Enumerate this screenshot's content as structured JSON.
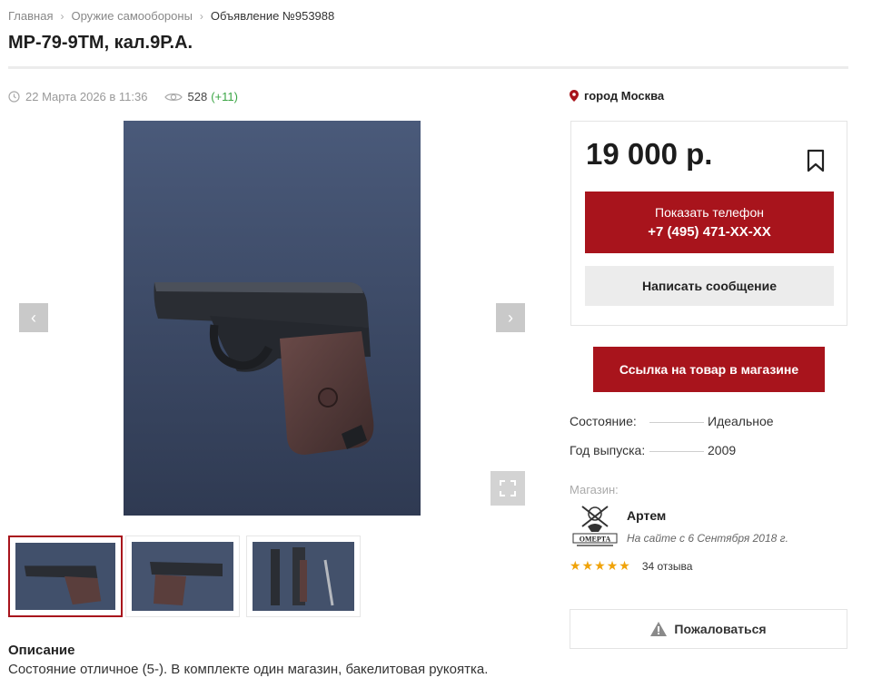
{
  "breadcrumb": [
    "Главная",
    "Оружие самообороны",
    "Объявление №953988"
  ],
  "title": "МР-79-9ТМ, кал.9Р.А.",
  "meta": {
    "date": "22 Марта 2026 в 11:36",
    "views": "528",
    "views_delta": "(+11)"
  },
  "gallery": {
    "prev_icon": "chevron-left-icon",
    "next_icon": "chevron-right-icon",
    "fullscreen_icon": "fullscreen-icon",
    "thumbnail_count": 3
  },
  "location": "город Москва",
  "price": "19 000 р.",
  "buttons": {
    "show_phone": "Показать телефон",
    "phone": "+7 (495) 471-XX-XX",
    "write_message": "Написать сообщение",
    "shop_link": "Ссылка на товар в магазине",
    "report": "Пожаловаться"
  },
  "specs": [
    {
      "label": "Состояние:",
      "value": "Идеальное"
    },
    {
      "label": "Год выпуска:",
      "value": "2009"
    }
  ],
  "shop": {
    "label": "Магазин:",
    "seller": "Артем",
    "since": "На сайте с 6 Сентября 2018 г.",
    "logo_text": "OMEPTA",
    "rating": 5,
    "reviews": "34 отзыва"
  },
  "description": {
    "heading": "Описание",
    "text": "Состояние отличное (5-). В комплекте один магазин, бакелитовая рукоятка."
  },
  "colors": {
    "accent": "#a8141c",
    "green": "#3aa544",
    "star": "#f0a30a"
  }
}
